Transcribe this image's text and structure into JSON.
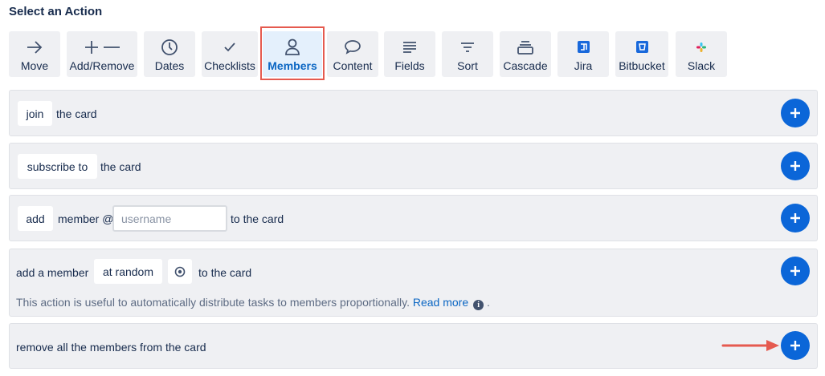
{
  "page": {
    "title": "Select an Action"
  },
  "tabs": [
    {
      "label": "Move",
      "icon": "arrow-right-icon"
    },
    {
      "label": "Add/Remove",
      "icon": "plus-minus-icon"
    },
    {
      "label": "Dates",
      "icon": "clock-icon"
    },
    {
      "label": "Checklists",
      "icon": "check-icon"
    },
    {
      "label": "Members",
      "icon": "person-icon",
      "active": true
    },
    {
      "label": "Content",
      "icon": "speech-bubble-icon"
    },
    {
      "label": "Fields",
      "icon": "lines-icon"
    },
    {
      "label": "Sort",
      "icon": "filter-icon"
    },
    {
      "label": "Cascade",
      "icon": "stack-icon"
    },
    {
      "label": "Jira",
      "icon": "jira-logo-icon"
    },
    {
      "label": "Bitbucket",
      "icon": "bitbucket-logo-icon"
    },
    {
      "label": "Slack",
      "icon": "slack-logo-icon"
    }
  ],
  "actions": {
    "join": {
      "chip": "join",
      "text": "the card"
    },
    "subscribe": {
      "chip": "subscribe to",
      "text": "the card"
    },
    "add": {
      "chip": "add",
      "text": "member @",
      "placeholder": "username",
      "suffix": "to the card"
    },
    "random": {
      "prefix": "add a member",
      "chip": "at random",
      "suffix": "to the card",
      "hint": "This action is useful to automatically distribute tasks to members proportionally.",
      "link": "Read more",
      "hint_end": ".",
      "info_glyph": "i"
    },
    "remove": {
      "text": "remove all the members from the card"
    }
  },
  "colors": {
    "accent": "#0b66d8",
    "active_tab_bg": "#e4f0fc",
    "highlight_frame": "#e55a4f",
    "row_bg": "#eff0f3"
  }
}
